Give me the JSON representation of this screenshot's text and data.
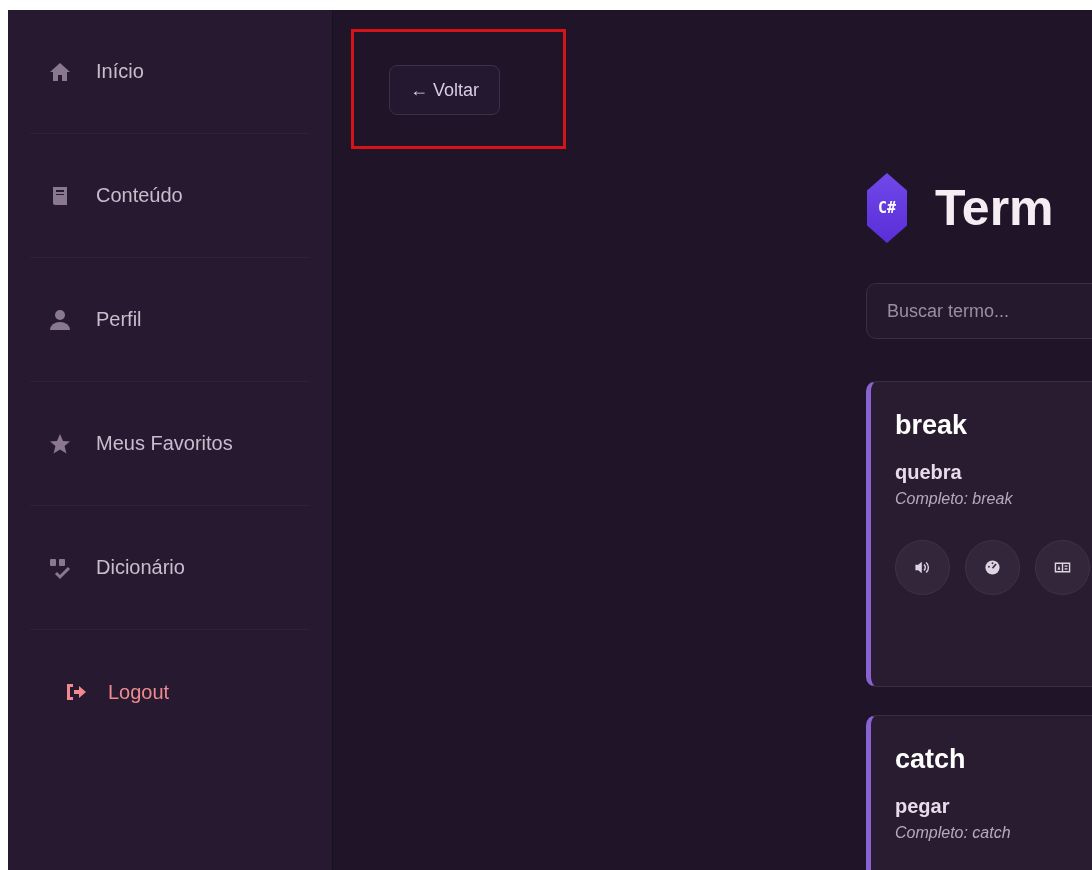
{
  "sidebar": {
    "items": [
      {
        "label": "Início",
        "kind": "nav"
      },
      {
        "label": "Conteúdo",
        "kind": "nav"
      },
      {
        "label": "Perfil",
        "kind": "nav"
      },
      {
        "label": "Meus Favoritos",
        "kind": "nav"
      },
      {
        "label": "Dicionário",
        "kind": "nav"
      },
      {
        "label": "Logout",
        "kind": "logout"
      }
    ]
  },
  "back_button": {
    "label": "Voltar",
    "arrow": "←"
  },
  "header": {
    "logo": "C#",
    "title": "Term"
  },
  "search": {
    "placeholder": "Buscar termo..."
  },
  "terms": [
    {
      "term": "break",
      "translation": "quebra",
      "full": "Completo: break",
      "actions": [
        {
          "kind": "speaker"
        },
        {
          "kind": "gauge"
        },
        {
          "kind": "card"
        }
      ]
    },
    {
      "term": "catch",
      "translation": "pegar",
      "full": "Completo: catch"
    }
  ]
}
